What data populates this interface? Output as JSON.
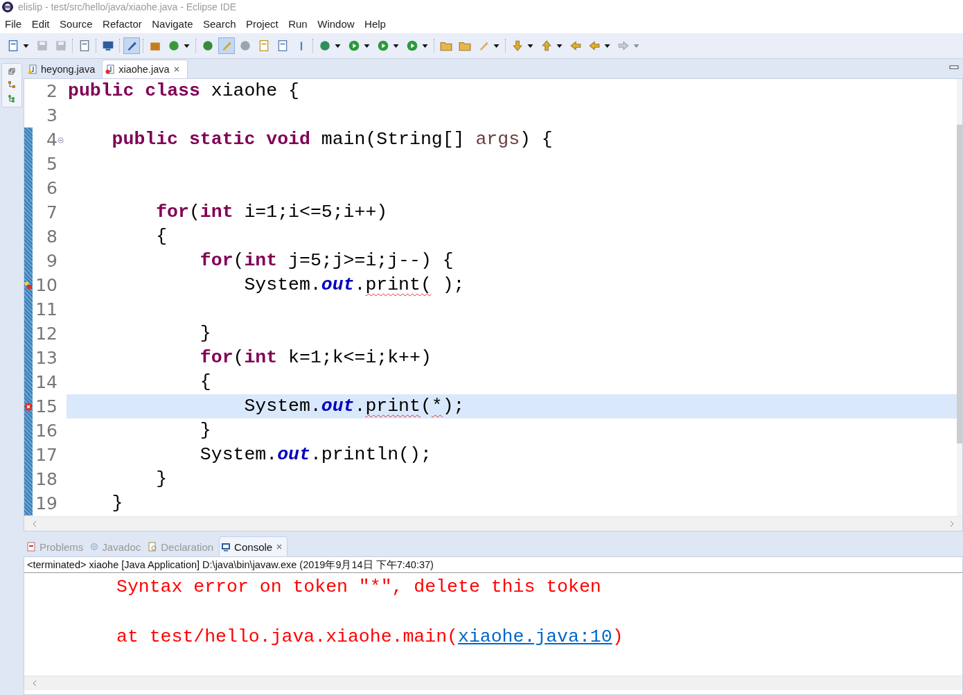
{
  "window": {
    "title": "elislip - test/src/hello/java/xiaohe.java - Eclipse IDE"
  },
  "menu": [
    "File",
    "Edit",
    "Source",
    "Refactor",
    "Navigate",
    "Search",
    "Project",
    "Run",
    "Window",
    "Help"
  ],
  "editor": {
    "tabs": [
      {
        "label": "heyong.java",
        "selected": false,
        "kind": "warning"
      },
      {
        "label": "xiaohe.java",
        "selected": true,
        "kind": "error"
      }
    ],
    "lines": [
      {
        "number": "2",
        "changed": false,
        "current": false,
        "foldable": false,
        "warning": false,
        "error": false,
        "tokens": [
          {
            "kind": "keyword",
            "text": "public "
          },
          {
            "kind": "keyword",
            "text": "class"
          },
          {
            "kind": "plain",
            "text": " xiaohe {"
          }
        ]
      },
      {
        "number": "3",
        "changed": false,
        "current": false,
        "foldable": false,
        "warning": false,
        "error": false
      },
      {
        "number": "4",
        "changed": true,
        "current": false,
        "foldable": true,
        "warning": false,
        "error": false,
        "tokens": [
          {
            "kind": "keyword",
            "text": "    public "
          },
          {
            "kind": "keyword",
            "text": "static "
          },
          {
            "kind": "keyword",
            "text": "void"
          },
          {
            "kind": "plain",
            "text": " main(String[] "
          },
          {
            "kind": "param",
            "text": "args"
          },
          {
            "kind": "plain",
            "text": ") {"
          }
        ]
      },
      {
        "number": "5",
        "changed": true,
        "current": false,
        "foldable": false,
        "warning": false,
        "error": false
      },
      {
        "number": "6",
        "changed": true,
        "current": false,
        "foldable": false,
        "warning": false,
        "error": false
      },
      {
        "number": "7",
        "changed": true,
        "current": false,
        "foldable": false,
        "warning": false,
        "error": false,
        "tokens": [
          {
            "kind": "keyword",
            "text": "        for"
          },
          {
            "kind": "plain",
            "text": "("
          },
          {
            "kind": "keyword",
            "text": "int"
          },
          {
            "kind": "plain",
            "text": " i=1;i<=5;i++)"
          }
        ]
      },
      {
        "number": "8",
        "changed": true,
        "current": false,
        "foldable": false,
        "warning": false,
        "error": false,
        "tokens": [
          {
            "kind": "plain",
            "text": "        {"
          }
        ]
      },
      {
        "number": "9",
        "changed": true,
        "current": false,
        "foldable": false,
        "warning": false,
        "error": false,
        "tokens": [
          {
            "kind": "keyword",
            "text": "            for"
          },
          {
            "kind": "plain",
            "text": "("
          },
          {
            "kind": "keyword",
            "text": "int"
          },
          {
            "kind": "plain",
            "text": " j=5;j>=i;j--) {"
          }
        ]
      },
      {
        "number": "10",
        "changed": true,
        "current": false,
        "foldable": false,
        "warning": true,
        "error": true,
        "tokens": [
          {
            "kind": "plain",
            "text": "                System."
          },
          {
            "kind": "field",
            "text": "out"
          },
          {
            "kind": "plain",
            "text": "."
          },
          {
            "kind": "squiggle",
            "text": "print("
          },
          {
            "kind": "plain",
            "text": " );"
          }
        ]
      },
      {
        "number": "11",
        "changed": true,
        "current": false,
        "foldable": false,
        "warning": false,
        "error": false
      },
      {
        "number": "12",
        "changed": true,
        "current": false,
        "foldable": false,
        "warning": false,
        "error": false,
        "tokens": [
          {
            "kind": "plain",
            "text": "            }"
          }
        ]
      },
      {
        "number": "13",
        "changed": true,
        "current": false,
        "foldable": false,
        "warning": false,
        "error": false,
        "tokens": [
          {
            "kind": "keyword",
            "text": "            for"
          },
          {
            "kind": "plain",
            "text": "("
          },
          {
            "kind": "keyword",
            "text": "int"
          },
          {
            "kind": "plain",
            "text": " k=1;k<=i;k++)"
          }
        ]
      },
      {
        "number": "14",
        "changed": true,
        "current": false,
        "foldable": false,
        "warning": false,
        "error": false,
        "tokens": [
          {
            "kind": "plain",
            "text": "            {"
          }
        ]
      },
      {
        "number": "15",
        "changed": true,
        "current": true,
        "foldable": false,
        "warning": false,
        "error": true,
        "tokens": [
          {
            "kind": "plain",
            "text": "                System."
          },
          {
            "kind": "field",
            "text": "out"
          },
          {
            "kind": "plain",
            "text": "."
          },
          {
            "kind": "squiggle",
            "text": "print"
          },
          {
            "kind": "plain",
            "text": "("
          },
          {
            "kind": "squiggle",
            "text": "*"
          },
          {
            "kind": "plain",
            "text": ");"
          }
        ]
      },
      {
        "number": "16",
        "changed": true,
        "current": false,
        "foldable": false,
        "warning": false,
        "error": false,
        "tokens": [
          {
            "kind": "plain",
            "text": "            }"
          }
        ]
      },
      {
        "number": "17",
        "changed": true,
        "current": false,
        "foldable": false,
        "warning": false,
        "error": false,
        "tokens": [
          {
            "kind": "plain",
            "text": "            System."
          },
          {
            "kind": "field",
            "text": "out"
          },
          {
            "kind": "plain",
            "text": ".println();"
          }
        ]
      },
      {
        "number": "18",
        "changed": true,
        "current": false,
        "foldable": false,
        "warning": false,
        "error": false,
        "tokens": [
          {
            "kind": "plain",
            "text": "        }"
          }
        ]
      },
      {
        "number": "19",
        "changed": true,
        "current": false,
        "foldable": false,
        "warning": false,
        "error": false,
        "tokens": [
          {
            "kind": "plain",
            "text": "    }"
          }
        ]
      }
    ]
  },
  "console": {
    "tabs": [
      {
        "label": "Problems",
        "selected": false,
        "kind": "problems"
      },
      {
        "label": "Javadoc",
        "selected": false,
        "kind": "javadoc"
      },
      {
        "label": "Declaration",
        "selected": false,
        "kind": "declaration"
      },
      {
        "label": "Console",
        "selected": true,
        "kind": "console"
      }
    ],
    "header": "<terminated> xiaohe [Java Application] D:\\java\\bin\\javaw.exe (2019年9月14日 下午7:40:37)",
    "output": [
      {
        "kind": "text",
        "text": "Syntax error on token \"*\", delete this token"
      },
      {
        "kind": "trace",
        "prefix": "at test/hello.java.xiaohe.main(",
        "link": "xiaohe.java:10",
        "suffix": ")"
      }
    ]
  }
}
